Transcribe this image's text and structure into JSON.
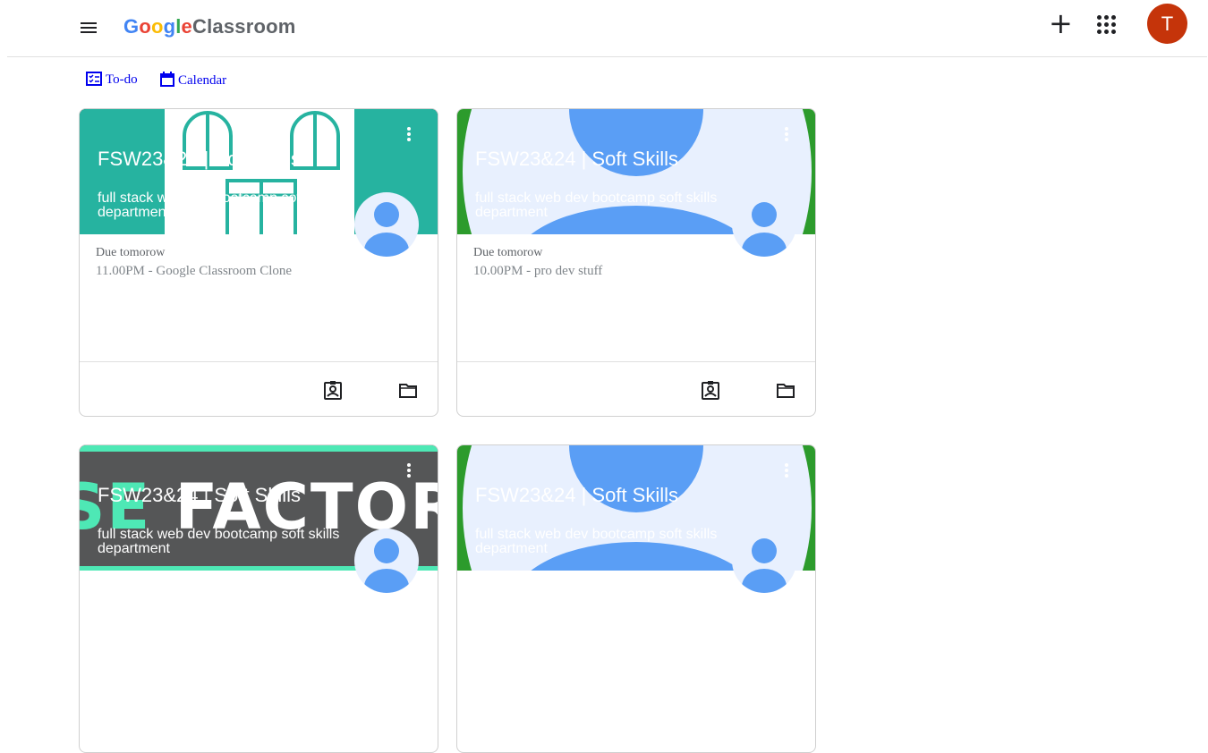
{
  "header": {
    "brand_google": [
      "G",
      "o",
      "o",
      "g",
      "l",
      "e"
    ],
    "brand_product": "Classroom",
    "avatar_initial": "T",
    "avatar_color": "#c5340a"
  },
  "nav": {
    "todo_label": "To-do",
    "calendar_label": "Calendar",
    "link_color": "#0000ee"
  },
  "cards": [
    {
      "title": "FSW23&24 | Soft Skills",
      "subtitle": "full stack web dev bootcamp soft skills department",
      "due_label": "Due tomorow",
      "due_item": "11.00PM - Google Classroom Clone",
      "theme": "teal-building"
    },
    {
      "title": "FSW23&24 | Soft Skills",
      "subtitle": "full stack web dev bootcamp soft skills department",
      "due_label": "Due tomorow",
      "due_item": "10.00PM - pro dev stuff",
      "theme": "green-circles"
    },
    {
      "title": "FSW23&24 | Soft Skills",
      "subtitle": "full stack web dev bootcamp soft skills department",
      "due_label": "",
      "due_item": "",
      "theme": "factory",
      "banner_text": "SE FACTORY"
    },
    {
      "title": "FSW23&24 | Soft Skills",
      "subtitle": "full stack web dev bootcamp soft skills department",
      "due_label": "",
      "due_item": "",
      "theme": "green-circles"
    }
  ],
  "colors": {
    "teal": "#26b3a0",
    "green": "#2c9b2c",
    "light_blue": "#e8f0fe",
    "blue": "#5a9ef5",
    "factory_grey": "#555657",
    "factory_mint": "#4ee8b5"
  }
}
